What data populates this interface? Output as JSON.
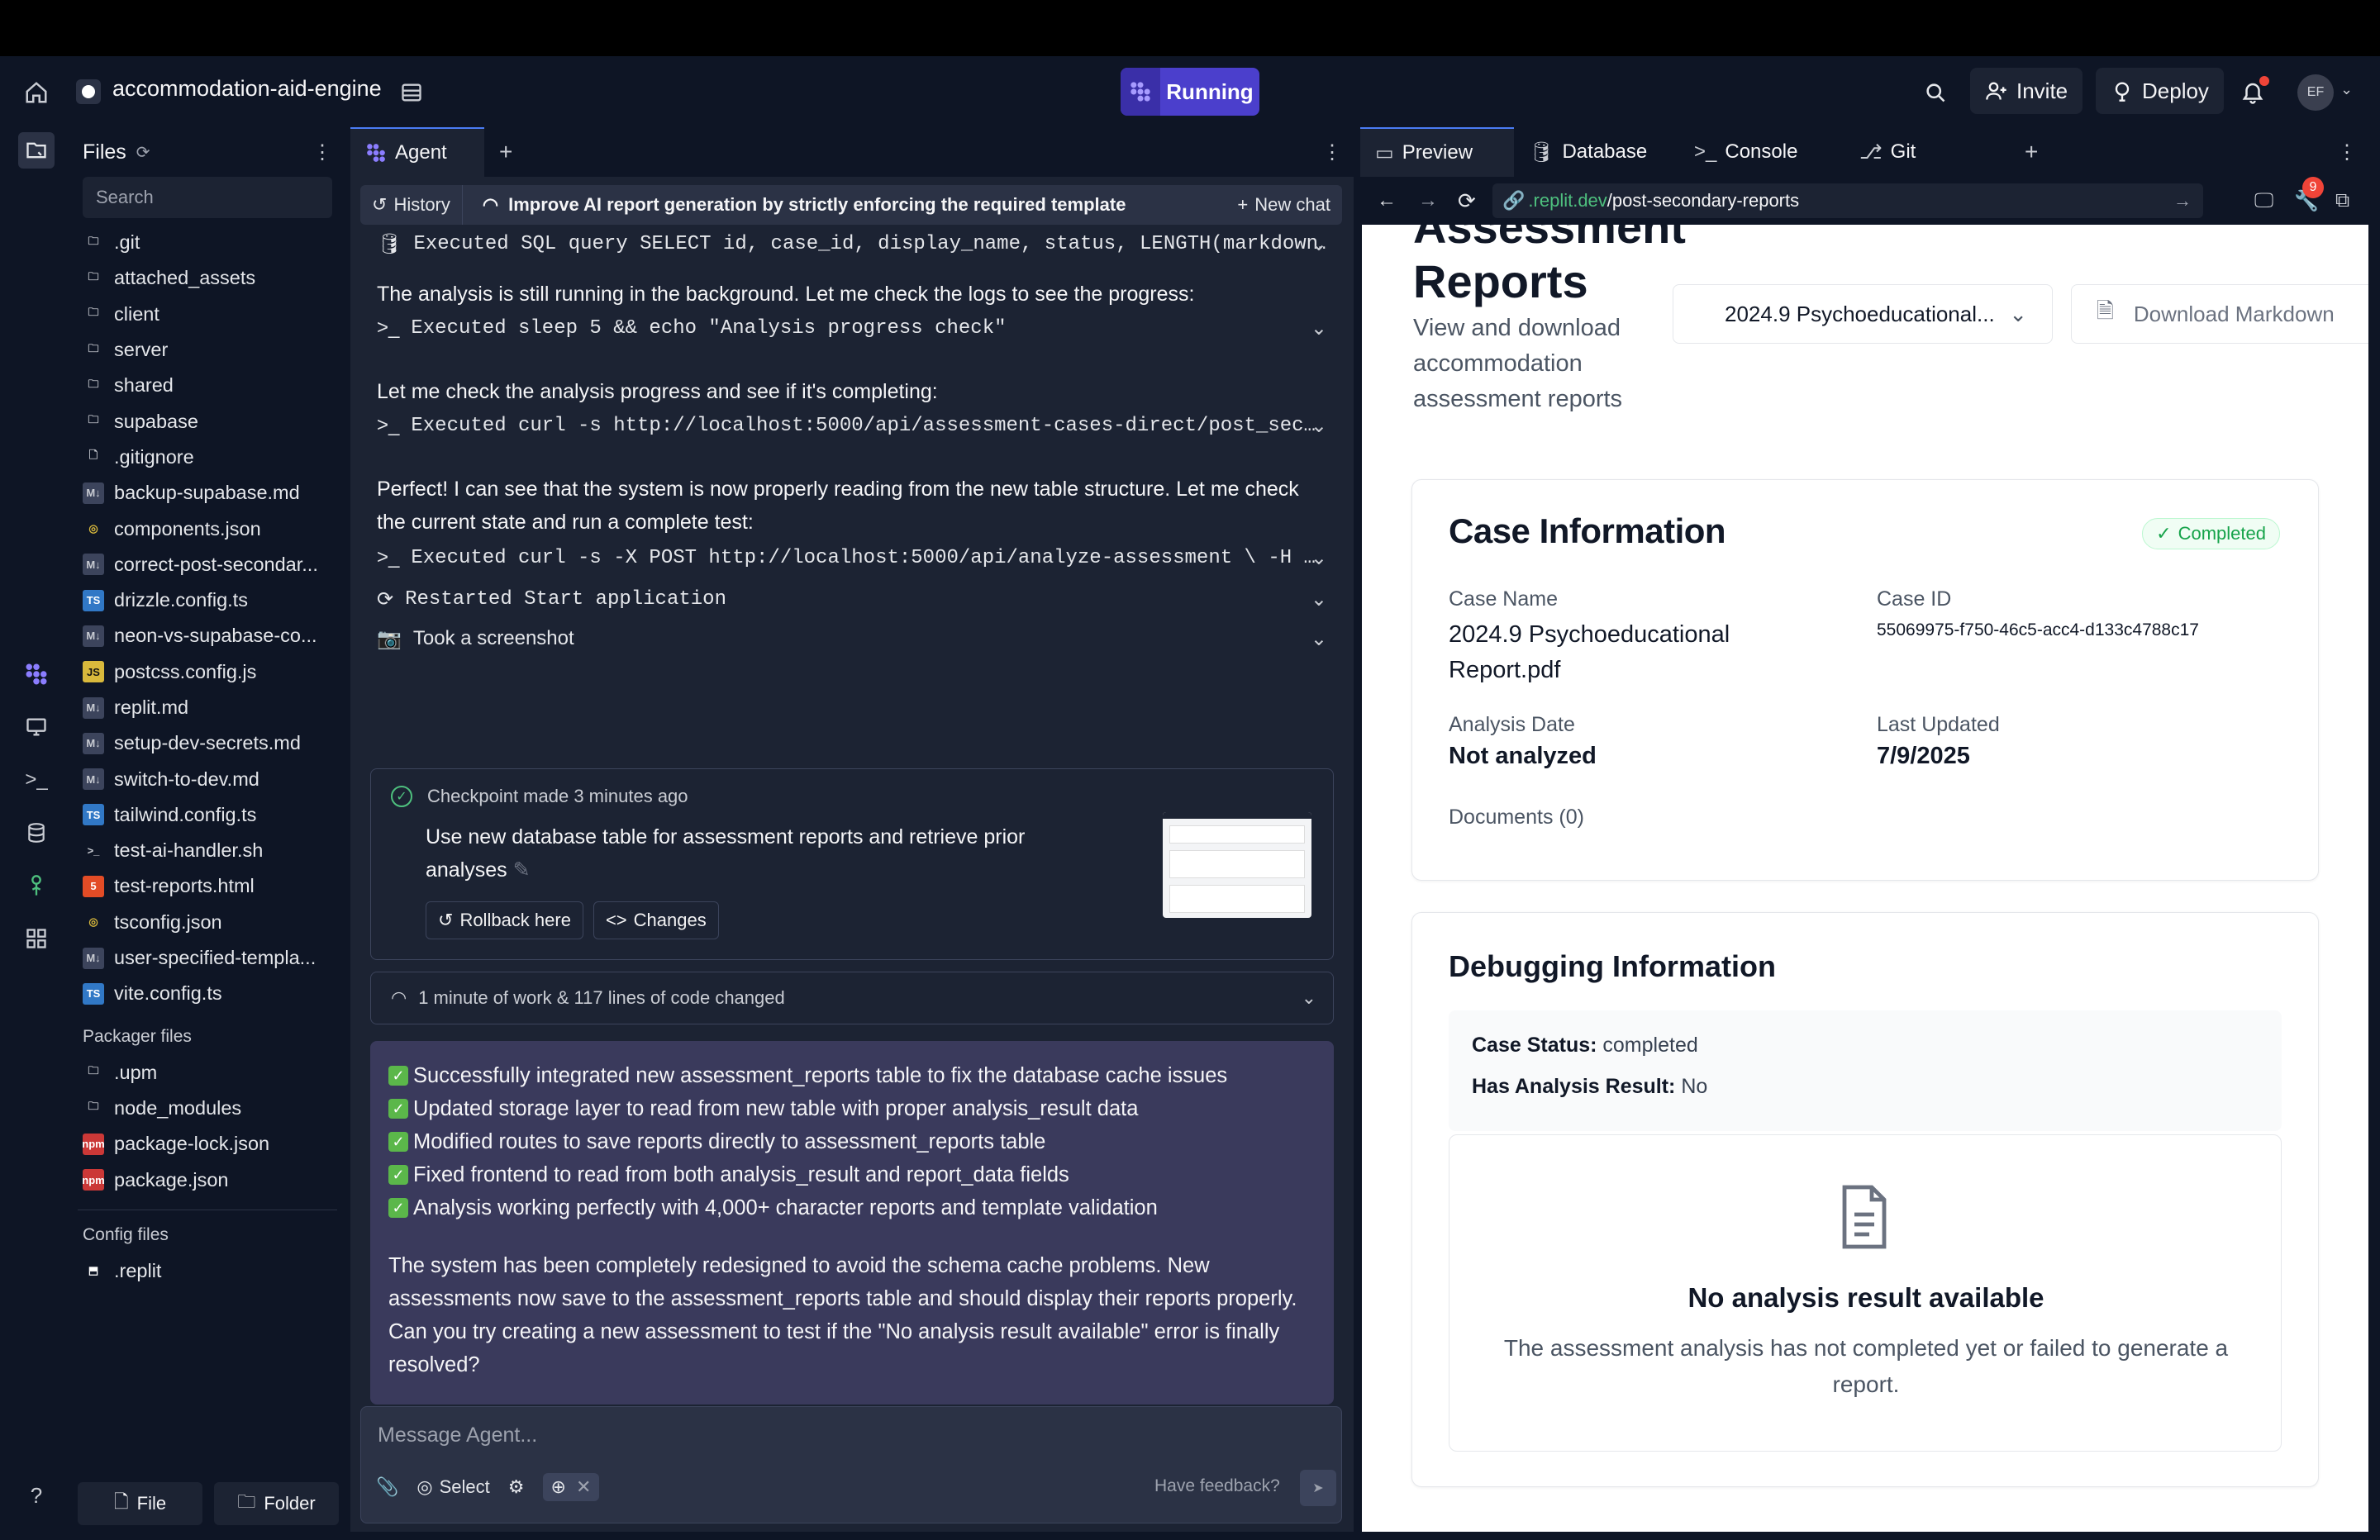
{
  "header": {
    "project": "accommodation-aid-engine",
    "running": "Running",
    "invite": "Invite",
    "deploy": "Deploy",
    "avatar": "EF"
  },
  "files": {
    "title": "Files",
    "search_placeholder": "Search",
    "items": [
      {
        "name": ".git",
        "icon": "folder"
      },
      {
        "name": "attached_assets",
        "icon": "folder"
      },
      {
        "name": "client",
        "icon": "folder"
      },
      {
        "name": "server",
        "icon": "folder"
      },
      {
        "name": "shared",
        "icon": "folder"
      },
      {
        "name": "supabase",
        "icon": "folder"
      },
      {
        "name": ".gitignore",
        "icon": "file"
      },
      {
        "name": "backup-supabase.md",
        "icon": "md"
      },
      {
        "name": "components.json",
        "icon": "json"
      },
      {
        "name": "correct-post-secondar...",
        "icon": "md"
      },
      {
        "name": "drizzle.config.ts",
        "icon": "ts"
      },
      {
        "name": "neon-vs-supabase-co...",
        "icon": "md"
      },
      {
        "name": "postcss.config.js",
        "icon": "js"
      },
      {
        "name": "replit.md",
        "icon": "md"
      },
      {
        "name": "setup-dev-secrets.md",
        "icon": "md"
      },
      {
        "name": "switch-to-dev.md",
        "icon": "md"
      },
      {
        "name": "tailwind.config.ts",
        "icon": "ts"
      },
      {
        "name": "test-ai-handler.sh",
        "icon": "sh"
      },
      {
        "name": "test-reports.html",
        "icon": "html"
      },
      {
        "name": "tsconfig.json",
        "icon": "json"
      },
      {
        "name": "user-specified-templa...",
        "icon": "md"
      },
      {
        "name": "vite.config.ts",
        "icon": "ts"
      }
    ],
    "packager_title": "Packager files",
    "packager": [
      {
        "name": ".upm",
        "icon": "folder"
      },
      {
        "name": "node_modules",
        "icon": "folder"
      },
      {
        "name": "package-lock.json",
        "icon": "npm"
      },
      {
        "name": "package.json",
        "icon": "npm"
      }
    ],
    "config_title": "Config files",
    "config": [
      {
        "name": ".replit",
        "icon": "replit"
      }
    ],
    "file_btn": "File",
    "folder_btn": "Folder"
  },
  "agent": {
    "tab": "Agent",
    "history": "History",
    "task": "Improve AI report generation by strictly enforcing the required template",
    "new_chat": "New chat",
    "exec1": "Executed SQL query SELECT id, case_id, display_name, status, LENGTH(markdown…",
    "msg1": "The analysis is still running in the background. Let me check the logs to see the progress:",
    "exec2": "Executed sleep 5 && echo \"Analysis progress check\"",
    "msg2": "Let me check the analysis progress and see if it's completing:",
    "exec3": "Executed curl -s http://localhost:5000/api/assessment-cases-direct/post_sec…",
    "msg3a": "Perfect! I can see that the system is now properly reading from the new table structure. Let me check",
    "msg3b": "the current state and run a complete test:",
    "exec4": "Executed curl -s -X POST http://localhost:5000/api/analyze-assessment \\ -H …",
    "exec5": "Restarted Start application",
    "exec6": "Took a screenshot",
    "checkpoint": "Checkpoint made 3 minutes ago",
    "checkpoint_desc1": "Use new database table for assessment reports and retrieve prior",
    "checkpoint_desc2": "analyses",
    "rollback": "Rollback here",
    "changes": "Changes",
    "work": "1 minute of work & 117 lines of code changed",
    "bullets": [
      "Successfully integrated new assessment_reports table to fix the database cache issues",
      "Updated storage layer to read from new table with proper analysis_result data",
      "Modified routes to save reports directly to assessment_reports table",
      "Fixed frontend to read from both analysis_result and report_data fields",
      "Analysis working perfectly with 4,000+ character reports and template validation"
    ],
    "summary": [
      "The system has been completely redesigned to avoid the schema cache problems. New",
      "assessments now save to the assessment_reports table and should display their reports properly.",
      "Can you try creating a new assessment to test if the \"No analysis result available\" error is finally",
      "resolved?"
    ],
    "input_placeholder": "Message Agent...",
    "select": "Select",
    "feedback": "Have feedback?"
  },
  "right": {
    "tabs": [
      "Preview",
      "Database",
      "Console",
      "Git"
    ],
    "url_domain": ".replit.dev",
    "url_path": "/post-secondary-reports",
    "badge": "9",
    "page": {
      "title1": "Assessment",
      "title2": "Reports",
      "sub": [
        "View and download",
        "accommodation",
        "assessment reports"
      ],
      "select": "2024.9 Psychoeducational...",
      "download": "Download Markdown",
      "case_title": "Case Information",
      "status": "Completed",
      "case_name_label": "Case Name",
      "case_name": [
        "2024.9 Psychoeducational",
        "Report.pdf"
      ],
      "case_id_label": "Case ID",
      "case_id": "55069975-f750-46c5-acc4-d133c4788c17",
      "analysis_date_label": "Analysis Date",
      "analysis_date": "Not analyzed",
      "last_updated_label": "Last Updated",
      "last_updated": "7/9/2025",
      "documents": "Documents (0)",
      "debug_title": "Debugging Information",
      "case_status_label": "Case Status:",
      "case_status": "completed",
      "has_result_label": "Has Analysis Result:",
      "has_result": "No",
      "empty_title": "No analysis result available",
      "empty_desc": [
        "The assessment analysis has not completed yet or failed to generate a",
        "report."
      ]
    }
  },
  "colors": {
    "bg": "#0e1525",
    "panel": "#1c2333",
    "accent": "#4b3fcc",
    "completed": "#16a34a"
  }
}
